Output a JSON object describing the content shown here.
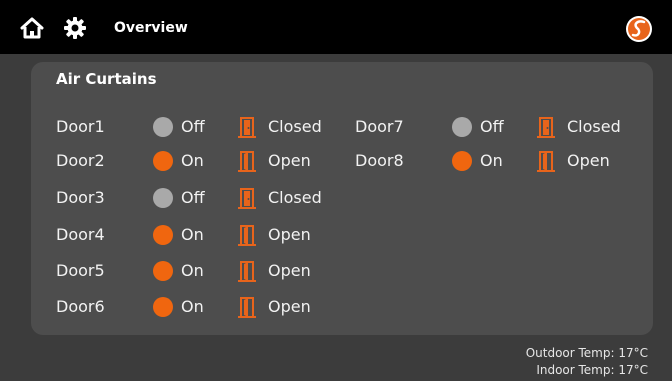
{
  "header": {
    "title": "Overview",
    "icons": [
      "home-icon",
      "gear-icon",
      "brand-logo"
    ]
  },
  "panel": {
    "title": "Air Curtains",
    "doors": [
      {
        "name": "Door1",
        "status": "Off",
        "state": "Closed"
      },
      {
        "name": "Door2",
        "status": "On",
        "state": "Open"
      },
      {
        "name": "Door3",
        "status": "Off",
        "state": "Closed"
      },
      {
        "name": "Door4",
        "status": "On",
        "state": "Open"
      },
      {
        "name": "Door5",
        "status": "On",
        "state": "Open"
      },
      {
        "name": "Door6",
        "status": "On",
        "state": "Open"
      },
      {
        "name": "Door7",
        "status": "Off",
        "state": "Closed"
      },
      {
        "name": "Door8",
        "status": "On",
        "state": "Open"
      }
    ]
  },
  "footer": {
    "outdoor_temp": "Outdoor Temp: 17°C",
    "indoor_temp": "Indoor Temp: 17°C"
  },
  "colors": {
    "on": "#f0660f",
    "off": "#a9a9a9",
    "accent": "#e8641b",
    "background": "#3c3c3c",
    "panel": "#4d4d4d",
    "topbar": "#000000"
  }
}
